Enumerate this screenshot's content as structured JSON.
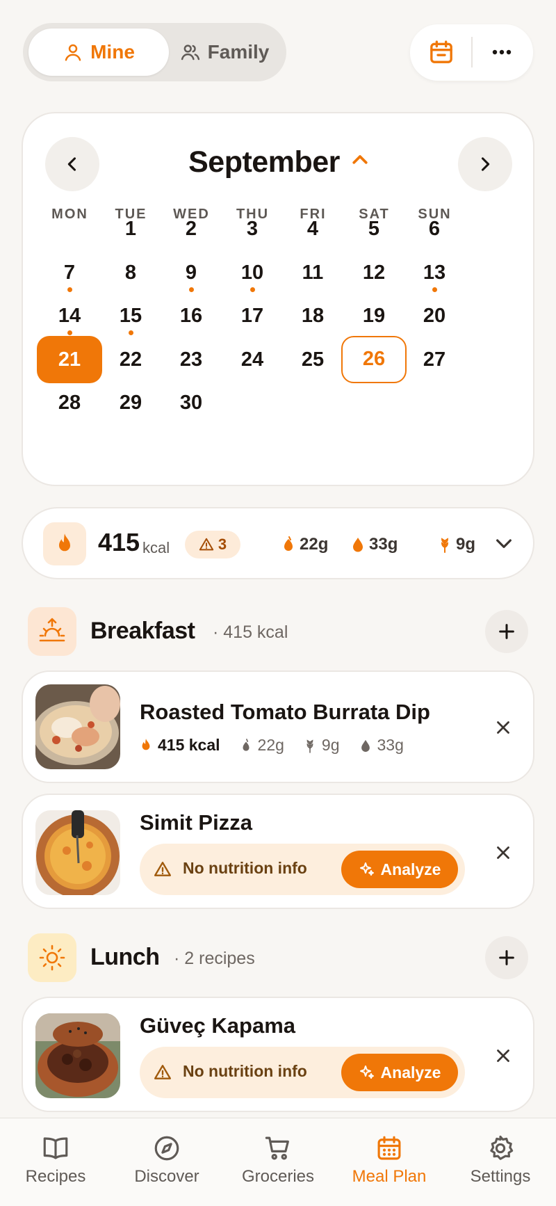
{
  "header": {
    "mine_label": "Mine",
    "family_label": "Family"
  },
  "calendar": {
    "month": "September",
    "weekdays": [
      "MON",
      "TUE",
      "WED",
      "THU",
      "FRI",
      "SAT",
      "SUN"
    ],
    "start_offset": 1,
    "days_in_month": 30,
    "selected_day": 21,
    "today": 26,
    "days_with_meals": [
      7,
      9,
      10,
      13,
      14,
      15
    ]
  },
  "summary": {
    "kcal": "415",
    "kcal_unit": "kcal",
    "warnings": "3",
    "protein": "22g",
    "fat": "33g",
    "carbs": "9g"
  },
  "breakfast": {
    "title": "Breakfast",
    "subtitle": "· 415 kcal",
    "items": [
      {
        "name": "Roasted Tomato Burrata Dip",
        "kcal": "415 kcal",
        "protein": "22g",
        "carbs": "9g",
        "fat": "33g"
      },
      {
        "name": "Simit Pizza",
        "nutrition_status": "No nutrition info",
        "analyze_label": "Analyze"
      }
    ]
  },
  "lunch": {
    "title": "Lunch",
    "subtitle": "· 2 recipes",
    "items": [
      {
        "name": "Güveç Kapama",
        "nutrition_status": "No nutrition info",
        "analyze_label": "Analyze"
      }
    ]
  },
  "tabs": [
    {
      "label": "Recipes",
      "icon": "book-icon"
    },
    {
      "label": "Discover",
      "icon": "compass-icon"
    },
    {
      "label": "Groceries",
      "icon": "cart-icon"
    },
    {
      "label": "Meal Plan",
      "icon": "calendar-icon",
      "active": true
    },
    {
      "label": "Settings",
      "icon": "gear-icon"
    }
  ],
  "colors": {
    "accent": "#f07708",
    "background": "#f8f6f3",
    "card": "#ffffff"
  }
}
